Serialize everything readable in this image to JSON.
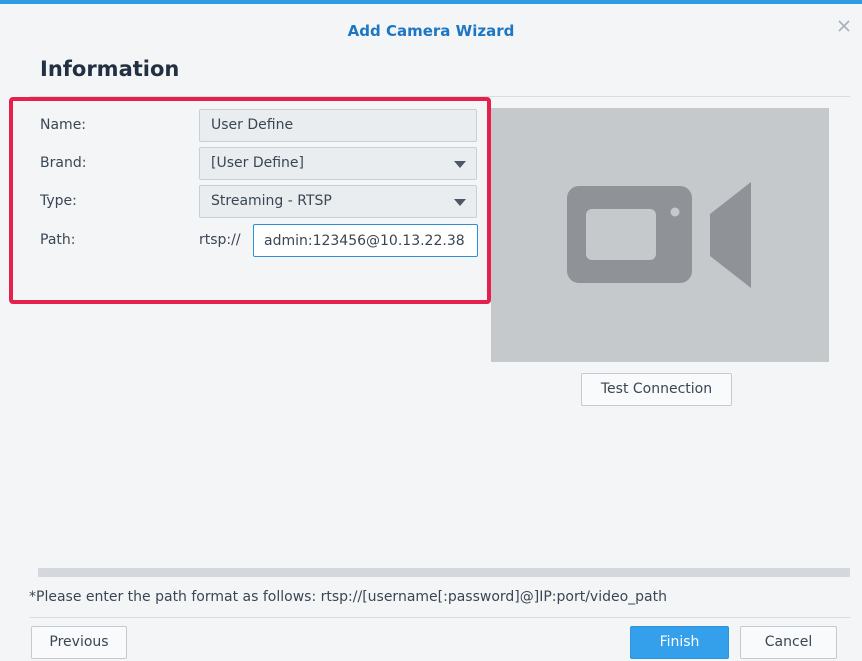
{
  "dialog": {
    "title": "Add Camera Wizard",
    "section_title": "Information"
  },
  "form": {
    "name_label": "Name:",
    "name_value": "User Define",
    "brand_label": "Brand:",
    "brand_value": "[User Define]",
    "type_label": "Type:",
    "type_value": "Streaming - RTSP",
    "path_label": "Path:",
    "path_prefix": "rtsp://",
    "path_value": "admin:123456@10.13.22.38"
  },
  "preview": {
    "test_button_label": "Test Connection"
  },
  "hint": "*Please enter the path format as follows: rtsp://[username[:password]@]IP:port/video_path",
  "footer": {
    "previous_label": "Previous",
    "finish_label": "Finish",
    "cancel_label": "Cancel"
  },
  "colors": {
    "accent": "#34a0ec",
    "title": "#1b76c4",
    "highlight": "#e5204c"
  },
  "icons": [
    "close-icon",
    "chevron-down-icon",
    "video-camera-icon"
  ]
}
